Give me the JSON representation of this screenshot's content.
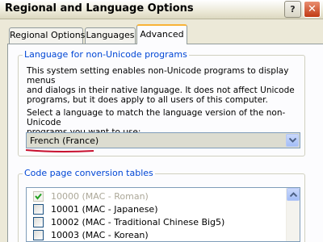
{
  "window": {
    "title": "Regional and Language Options",
    "help_glyph": "?",
    "close_glyph": "✕"
  },
  "tabs": [
    {
      "label": "Regional Options",
      "active": false
    },
    {
      "label": "Languages",
      "active": false
    },
    {
      "label": "Advanced",
      "active": true
    }
  ],
  "non_unicode": {
    "legend": "Language for non-Unicode programs",
    "description_lines": [
      "This system setting enables non-Unicode programs to display menus",
      "and dialogs in their native language. It does not affect Unicode",
      "programs, but it does apply to all users of this computer."
    ],
    "prompt_lines": [
      "Select a language to match the language version of the non-Unicode",
      "programs you want to use:"
    ],
    "selected_language": "French (France)"
  },
  "code_pages": {
    "legend": "Code page conversion tables",
    "items": [
      {
        "label": "10000 (MAC - Roman)",
        "checked": true,
        "disabled": true
      },
      {
        "label": "10001 (MAC - Japanese)",
        "checked": false,
        "disabled": false
      },
      {
        "label": "10002 (MAC - Traditional Chinese Big5)",
        "checked": false,
        "disabled": false
      },
      {
        "label": "10003 (MAC - Korean)",
        "checked": false,
        "disabled": false
      }
    ]
  },
  "colors": {
    "accent_blue": "#0046d5",
    "annotation_red": "#c8102e",
    "tab_highlight": "#f8b338"
  },
  "icons": {
    "help": "question-mark-icon",
    "close": "close-x-icon",
    "dropdown": "chevron-down-icon",
    "scroll_up": "chevron-up-icon",
    "check": "checkmark-icon"
  }
}
